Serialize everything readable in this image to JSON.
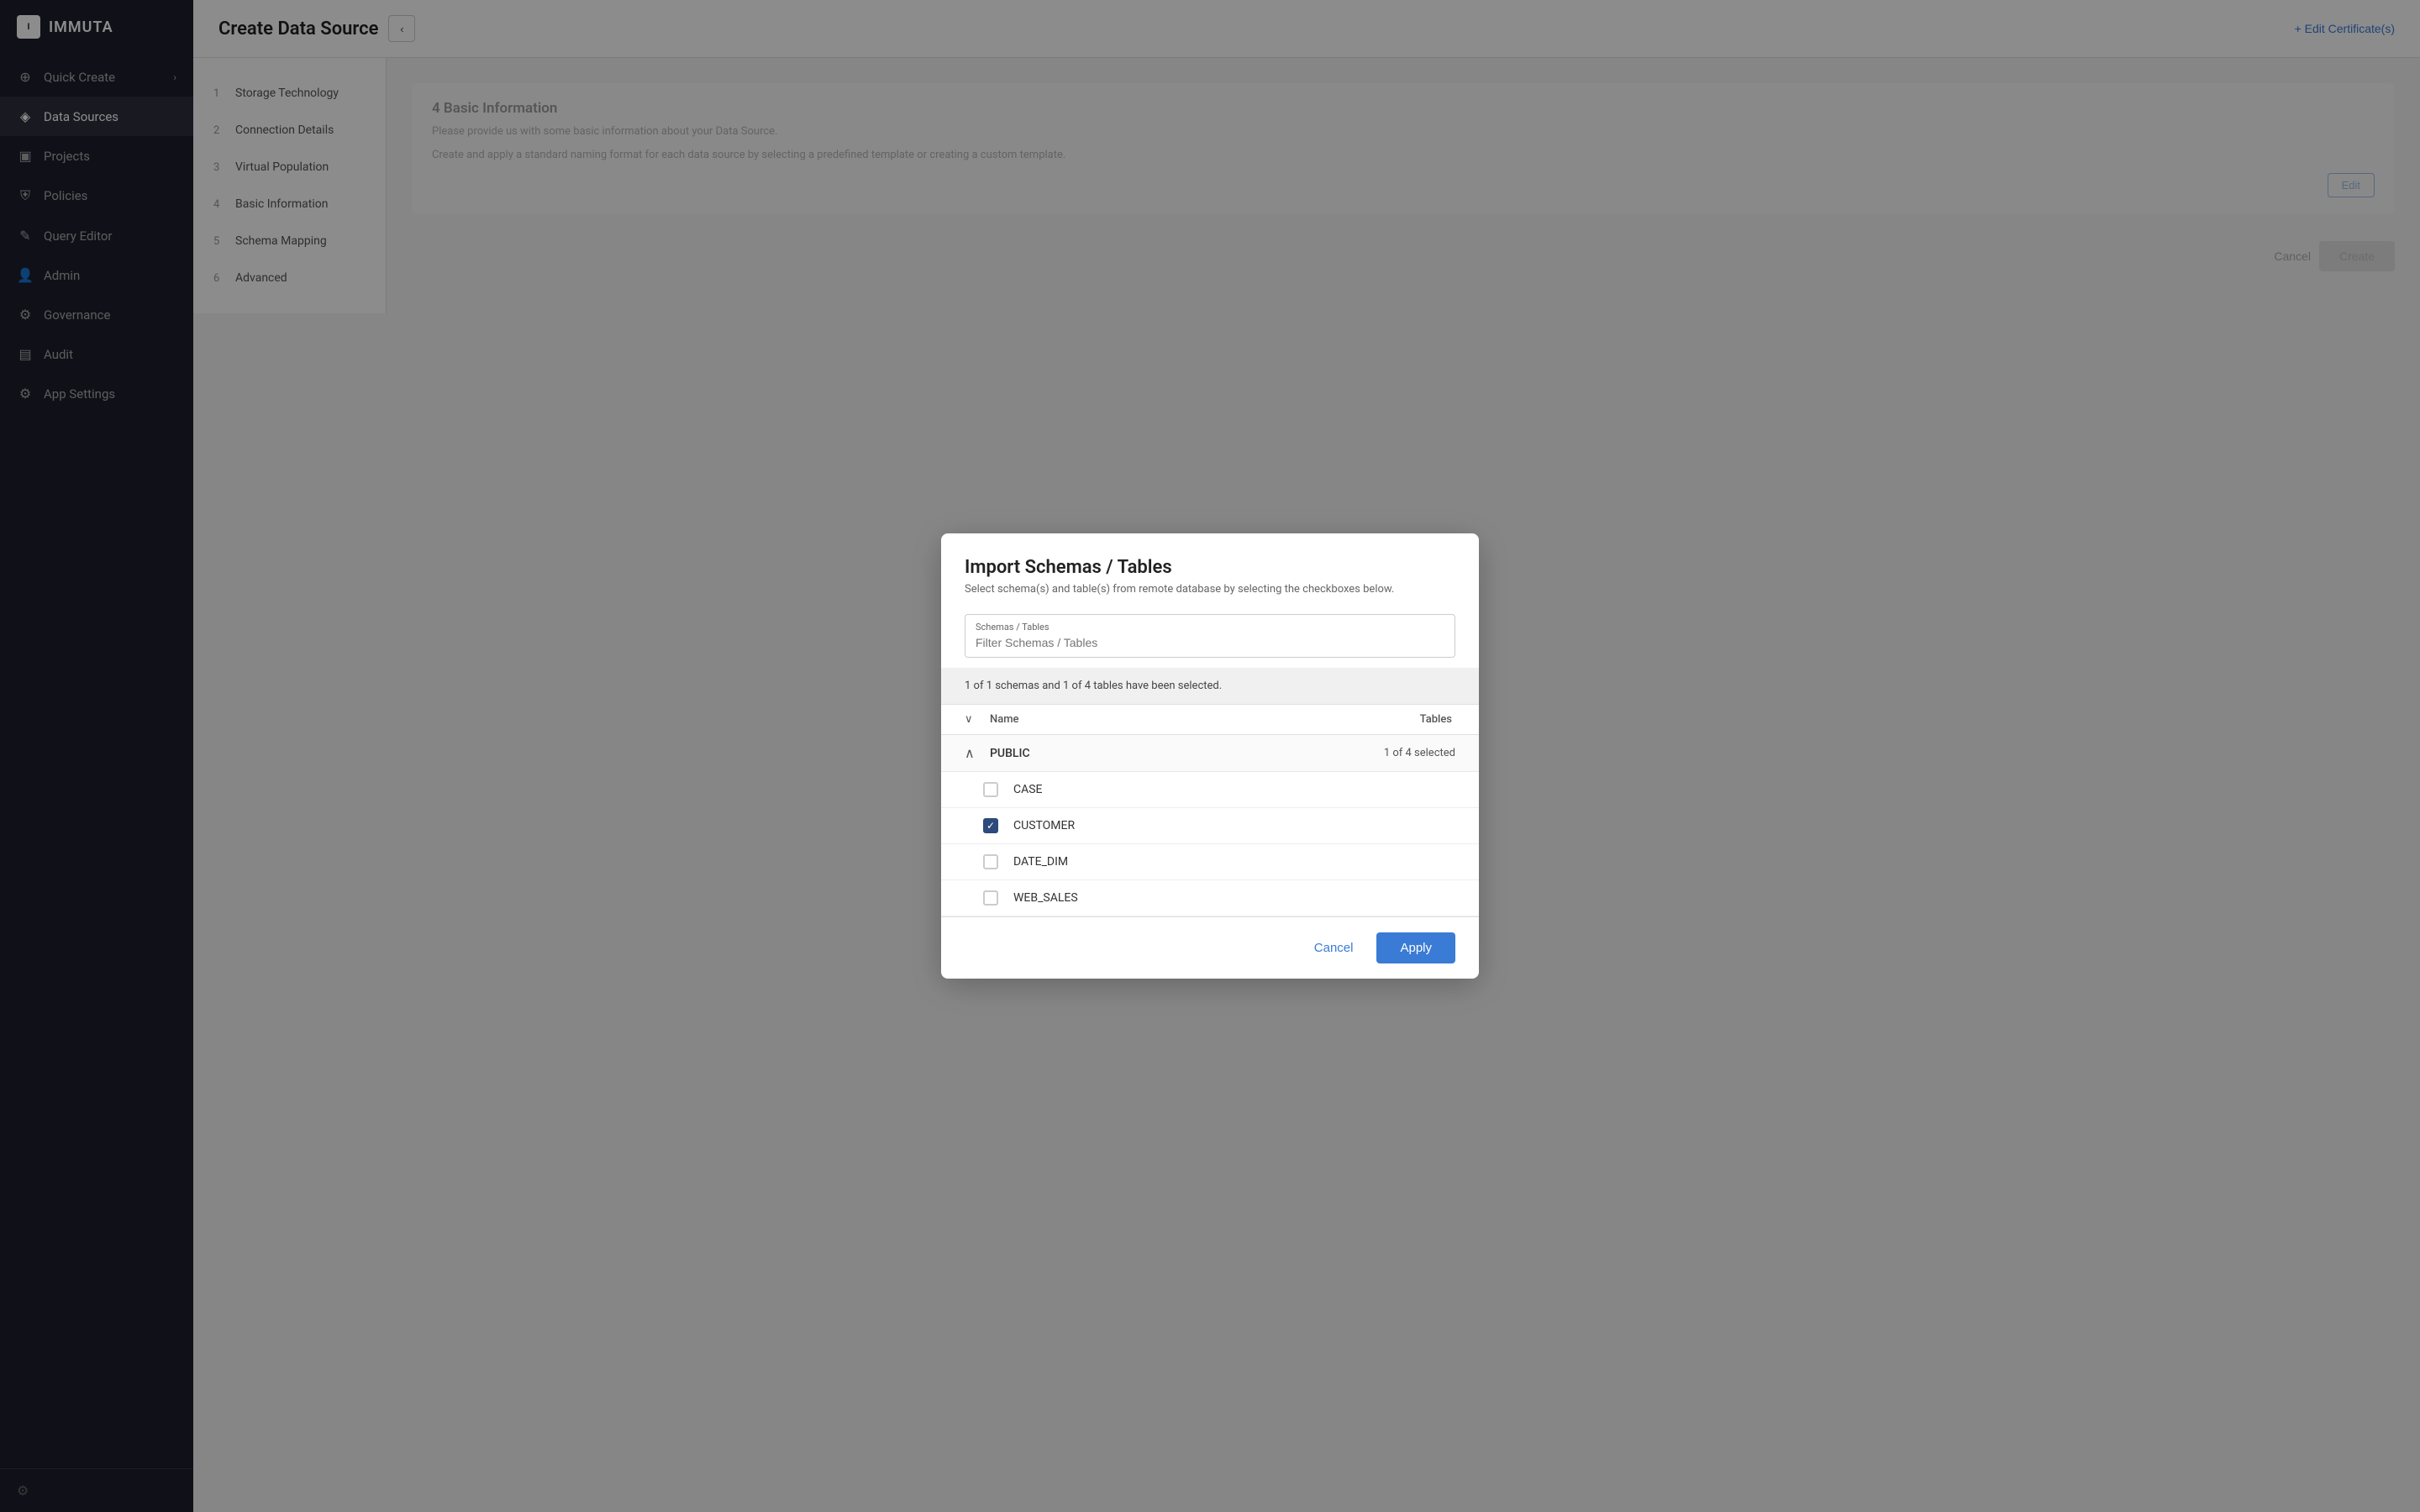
{
  "app": {
    "logo_text": "IMMUTA",
    "logo_box": "I"
  },
  "sidebar": {
    "items": [
      {
        "id": "quick-create",
        "label": "Quick Create",
        "icon": "⊕",
        "has_arrow": true,
        "active": false
      },
      {
        "id": "data-sources",
        "label": "Data Sources",
        "icon": "◈",
        "active": true
      },
      {
        "id": "projects",
        "label": "Projects",
        "icon": "▣",
        "active": false
      },
      {
        "id": "policies",
        "label": "Policies",
        "icon": "⛨",
        "active": false
      },
      {
        "id": "query-editor",
        "label": "Query Editor",
        "icon": "✎",
        "active": false
      },
      {
        "id": "admin",
        "label": "Admin",
        "icon": "👤",
        "active": false
      },
      {
        "id": "governance",
        "label": "Governance",
        "icon": "⚙",
        "active": false
      },
      {
        "id": "audit",
        "label": "Audit",
        "icon": "▤",
        "active": false
      },
      {
        "id": "app-settings",
        "label": "App Settings",
        "icon": "⚙",
        "active": false
      }
    ],
    "bottom_icon": "⚙"
  },
  "page": {
    "title": "Create Data Source",
    "back_button_label": "‹",
    "edit_cert_label": "+ Edit Certificate(s)"
  },
  "steps": [
    {
      "num": "1",
      "label": "Storage Technology"
    },
    {
      "num": "2",
      "label": "Connection Details"
    },
    {
      "num": "3",
      "label": "Virtual Population"
    },
    {
      "num": "4",
      "label": "Basic Information"
    },
    {
      "num": "5",
      "label": "Schema Mapping"
    },
    {
      "num": "6",
      "label": "Advanced"
    }
  ],
  "modal": {
    "title": "Import Schemas / Tables",
    "subtitle": "Select schema(s) and table(s) from remote database by selecting the checkboxes below.",
    "filter_label": "Schemas / Tables",
    "filter_placeholder": "Filter Schemas / Tables",
    "selection_status": "1 of 1 schemas and 1 of 4 tables have been selected.",
    "table_header_name": "Name",
    "table_header_tables": "Tables",
    "schemas": [
      {
        "name": "PUBLIC",
        "count_label": "1 of 4 selected",
        "expanded": true,
        "tables": [
          {
            "name": "CASE",
            "checked": false
          },
          {
            "name": "CUSTOMER",
            "checked": true
          },
          {
            "name": "DATE_DIM",
            "checked": false
          },
          {
            "name": "WEB_SALES",
            "checked": false
          }
        ]
      }
    ],
    "cancel_label": "Cancel",
    "apply_label": "Apply"
  },
  "background": {
    "section4_title": "4  Basic Information",
    "section4_desc": "Please provide us with some basic information about your Data Source.",
    "section4_text2": "Create and apply a standard naming format for each data source by selecting a predefined template or creating a custom template.",
    "edit_btn_label": "Edit",
    "cancel_label": "Cancel",
    "create_label": "Create"
  }
}
